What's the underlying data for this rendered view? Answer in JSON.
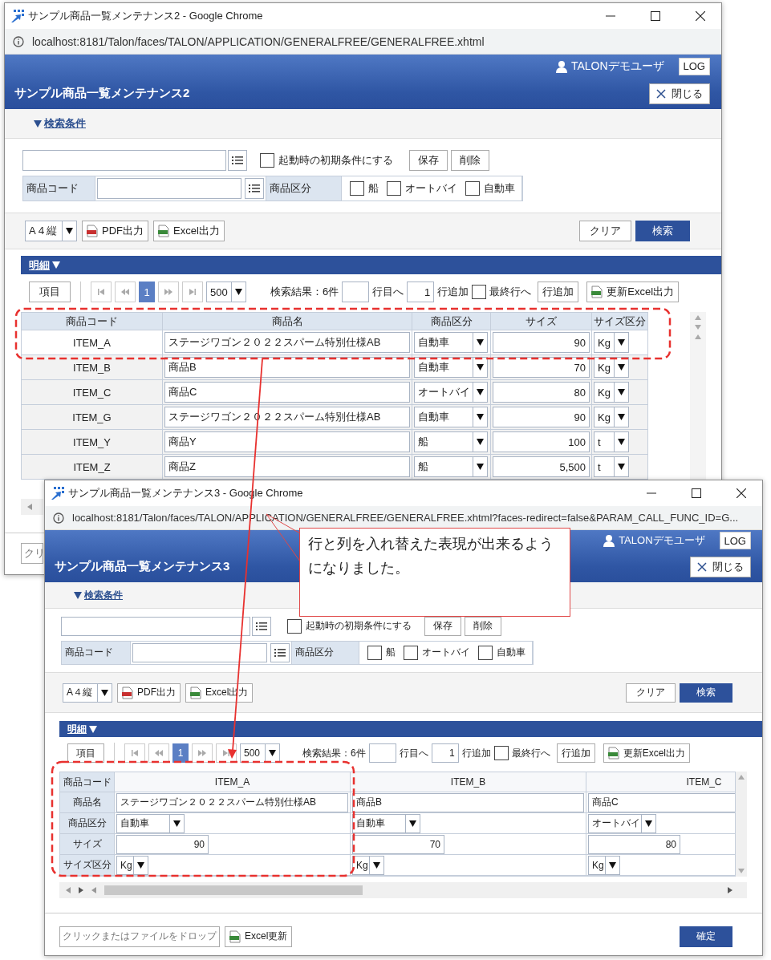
{
  "windows": [
    {
      "kind": "list",
      "title": "サンプル商品一覧メンテナンス2 - Google Chrome",
      "url": "localhost:8181/Talon/faces/TALON/APPLICATION/GENERALFREE/GENERALFREE.xhtml",
      "user": "TALONデモユーザ",
      "logout": "LOG",
      "app_title": "サンプル商品一覧メンテナンス2",
      "close": "閉じる",
      "search_toggle": "検索条件",
      "search_form": {
        "default_label": "起動時の初期条件にする",
        "default_checked": false,
        "save": "保存",
        "delete": "削除",
        "code_label": "商品コード",
        "kind_label": "商品区分",
        "kind_options": [
          {
            "label": "船",
            "checked": false
          },
          {
            "label": "オートバイ",
            "checked": false
          },
          {
            "label": "自動車",
            "checked": false
          }
        ]
      },
      "toolbar": {
        "paper": "A４縦",
        "pdf": "PDF出力",
        "excel": "Excel出力",
        "clear": "クリア",
        "search": "検索"
      },
      "detail": {
        "title": "明細",
        "items_button": "項目",
        "pages": [
          {
            "label": "1",
            "selected": true
          }
        ],
        "page_size": "500",
        "result": "検索結果：6件",
        "goto_label": "行目へ",
        "add_count": "1",
        "add_label": "行追加",
        "last_row_label": "最終行へ",
        "last_row_checked": false,
        "add_button": "行追加",
        "export": "更新Excel出力"
      },
      "table": {
        "columns": [
          "商品コード",
          "商品名",
          "商品区分",
          "サイズ",
          "サイズ区分"
        ],
        "rows": [
          {
            "code": "ITEM_A",
            "name": "ステージワゴン２０２２スパーム特別仕様AB",
            "kind": "自動車",
            "size": "90",
            "unit": "Kg",
            "selected": true
          },
          {
            "code": "ITEM_B",
            "name": "商品B",
            "kind": "自動車",
            "size": "70",
            "unit": "Kg",
            "selected": false
          },
          {
            "code": "ITEM_C",
            "name": "商品C",
            "kind": "オートバイ",
            "size": "80",
            "unit": "Kg",
            "selected": false
          },
          {
            "code": "ITEM_G",
            "name": "ステージワゴン２０２２スパーム特別仕様AB",
            "kind": "自動車",
            "size": "90",
            "unit": "Kg",
            "selected": false
          },
          {
            "code": "ITEM_Y",
            "name": "商品Y",
            "kind": "船",
            "size": "100",
            "unit": "t",
            "selected": false
          },
          {
            "code": "ITEM_Z",
            "name": "商品Z",
            "kind": "船",
            "size": "5,500",
            "unit": "t",
            "selected": false
          }
        ]
      },
      "footer": {
        "drop": "クリ"
      }
    },
    {
      "kind": "transposed",
      "title": "サンプル商品一覧メンテナンス3 - Google Chrome",
      "url": "localhost:8181/Talon/faces/TALON/APPLICATION/GENERALFREE/GENERALFREE.xhtml?faces-redirect=false&PARAM_CALL_FUNC_ID=G...",
      "user": "TALONデモユーザ",
      "logout": "LOG",
      "app_title": "サンプル商品一覧メンテナンス3",
      "close": "閉じる",
      "search_toggle": "検索条件",
      "search_form": {
        "default_label": "起動時の初期条件にする",
        "default_checked": false,
        "save": "保存",
        "delete": "削除",
        "code_label": "商品コード",
        "kind_label": "商品区分",
        "kind_options": [
          {
            "label": "船",
            "checked": false
          },
          {
            "label": "オートバイ",
            "checked": false
          },
          {
            "label": "自動車",
            "checked": false
          }
        ]
      },
      "toolbar": {
        "paper": "A４縦",
        "pdf": "PDF出力",
        "excel": "Excel出力",
        "clear": "クリア",
        "search": "検索"
      },
      "detail": {
        "title": "明細",
        "items_button": "項目",
        "pages": [
          {
            "label": "1",
            "selected": true
          }
        ],
        "page_size": "500",
        "result": "検索結果：6件",
        "goto_label": "行目へ",
        "add_count": "1",
        "add_label": "行追加",
        "last_row_label": "最終行へ",
        "last_row_checked": false,
        "add_button": "行追加",
        "export": "更新Excel出力"
      },
      "table": {
        "columns": [
          "商品コード",
          "商品名",
          "商品区分",
          "サイズ",
          "サイズ区分"
        ],
        "rows": [
          {
            "code": "ITEM_A",
            "name": "ステージワゴン２０２２スパーム特別仕様AB",
            "kind": "自動車",
            "size": "90",
            "unit": "Kg"
          },
          {
            "code": "ITEM_B",
            "name": "商品B",
            "kind": "自動車",
            "size": "70",
            "unit": "Kg"
          },
          {
            "code": "ITEM_C",
            "name": "商品C",
            "kind": "オートバイ",
            "size": "80",
            "unit": "Kg"
          }
        ]
      },
      "footer": {
        "drop": "クリックまたはファイルをドロップ",
        "excel_update": "Excel更新",
        "confirm": "確定"
      }
    }
  ],
  "callout": "行と列を入れ替えた表現が出来るようになりました。"
}
